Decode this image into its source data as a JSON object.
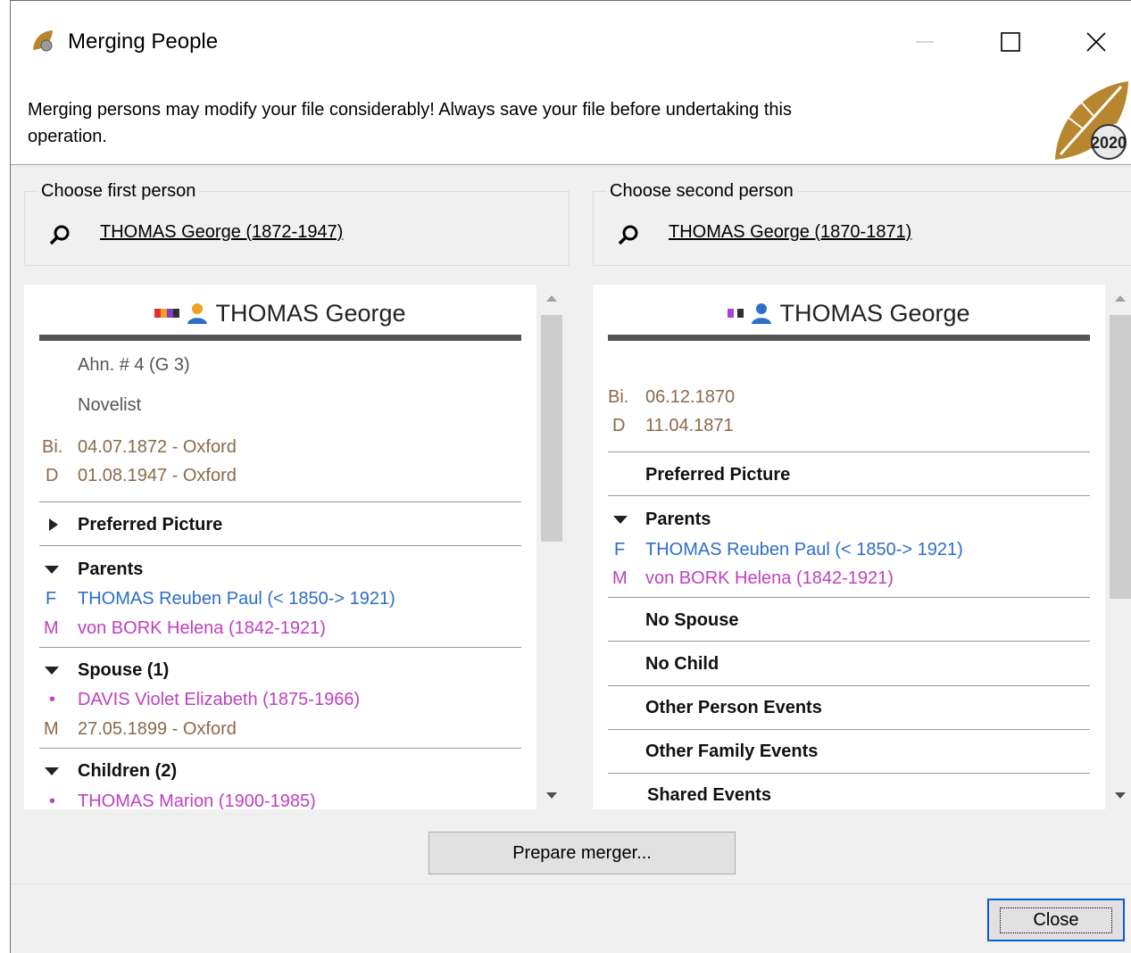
{
  "window": {
    "title": "Merging People",
    "icon": "leaf-app-icon",
    "controls": [
      "minimize-icon",
      "maximize-icon",
      "close-icon"
    ]
  },
  "warning": {
    "line1": "Merging persons may modify your file considerably! Always save your file before undertaking this",
    "line2": "operation."
  },
  "logo_text": "2020",
  "first": {
    "group_label": "Choose first person",
    "selected": "THOMAS George (1872-1947)",
    "panel": {
      "name": "THOMAS George",
      "chips": [
        "#e03030",
        "#f0a020",
        "#8040c0",
        "#303030"
      ],
      "sosa": "Ahn. # 4 (G 3)",
      "occupation": "Novelist",
      "birth_prefix": "Bi.",
      "birth": "04.07.1872 - Oxford",
      "death_prefix": "D",
      "death": "01.08.1947 - Oxford",
      "preferred_picture": "Preferred Picture",
      "parents_label": "Parents",
      "father_prefix": "F",
      "father": "THOMAS Reuben Paul (< 1850-> 1921)",
      "mother_prefix": "M",
      "mother": "von BORK Helena (1842-1921)",
      "spouse_label": "Spouse (1)",
      "spouse_bullet": "•",
      "spouse": "DAVIS Violet Elizabeth (1875-1966)",
      "marriage_prefix": "M",
      "marriage": "27.05.1899 - Oxford",
      "children_label": "Children (2)",
      "child_bullet": "•",
      "child1": "THOMAS Marion (1900-1985)"
    }
  },
  "second": {
    "group_label": "Choose second person",
    "selected": "THOMAS George (1870-1871)",
    "panel": {
      "name": "THOMAS George",
      "chips": [
        "#b040d0",
        "#303030"
      ],
      "birth_prefix": "Bi.",
      "birth": "06.12.1870",
      "death_prefix": "D",
      "death": "11.04.1871",
      "preferred_picture": "Preferred Picture",
      "parents_label": "Parents",
      "father_prefix": "F",
      "father": "THOMAS Reuben Paul (< 1850-> 1921)",
      "mother_prefix": "M",
      "mother": "von BORK Helena (1842-1921)",
      "no_spouse": "No Spouse",
      "no_child": "No Child",
      "other_person_events": "Other Person Events",
      "other_family_events": "Other Family Events",
      "shared_events": "Shared Events"
    }
  },
  "buttons": {
    "prepare": "Prepare merger...",
    "close": "Close"
  },
  "colors": {
    "link_blue": "#2d6ec8",
    "female_magenta": "#c040c0",
    "event_brown": "#8a6a4a",
    "focus_blue": "#0a5bd6"
  }
}
